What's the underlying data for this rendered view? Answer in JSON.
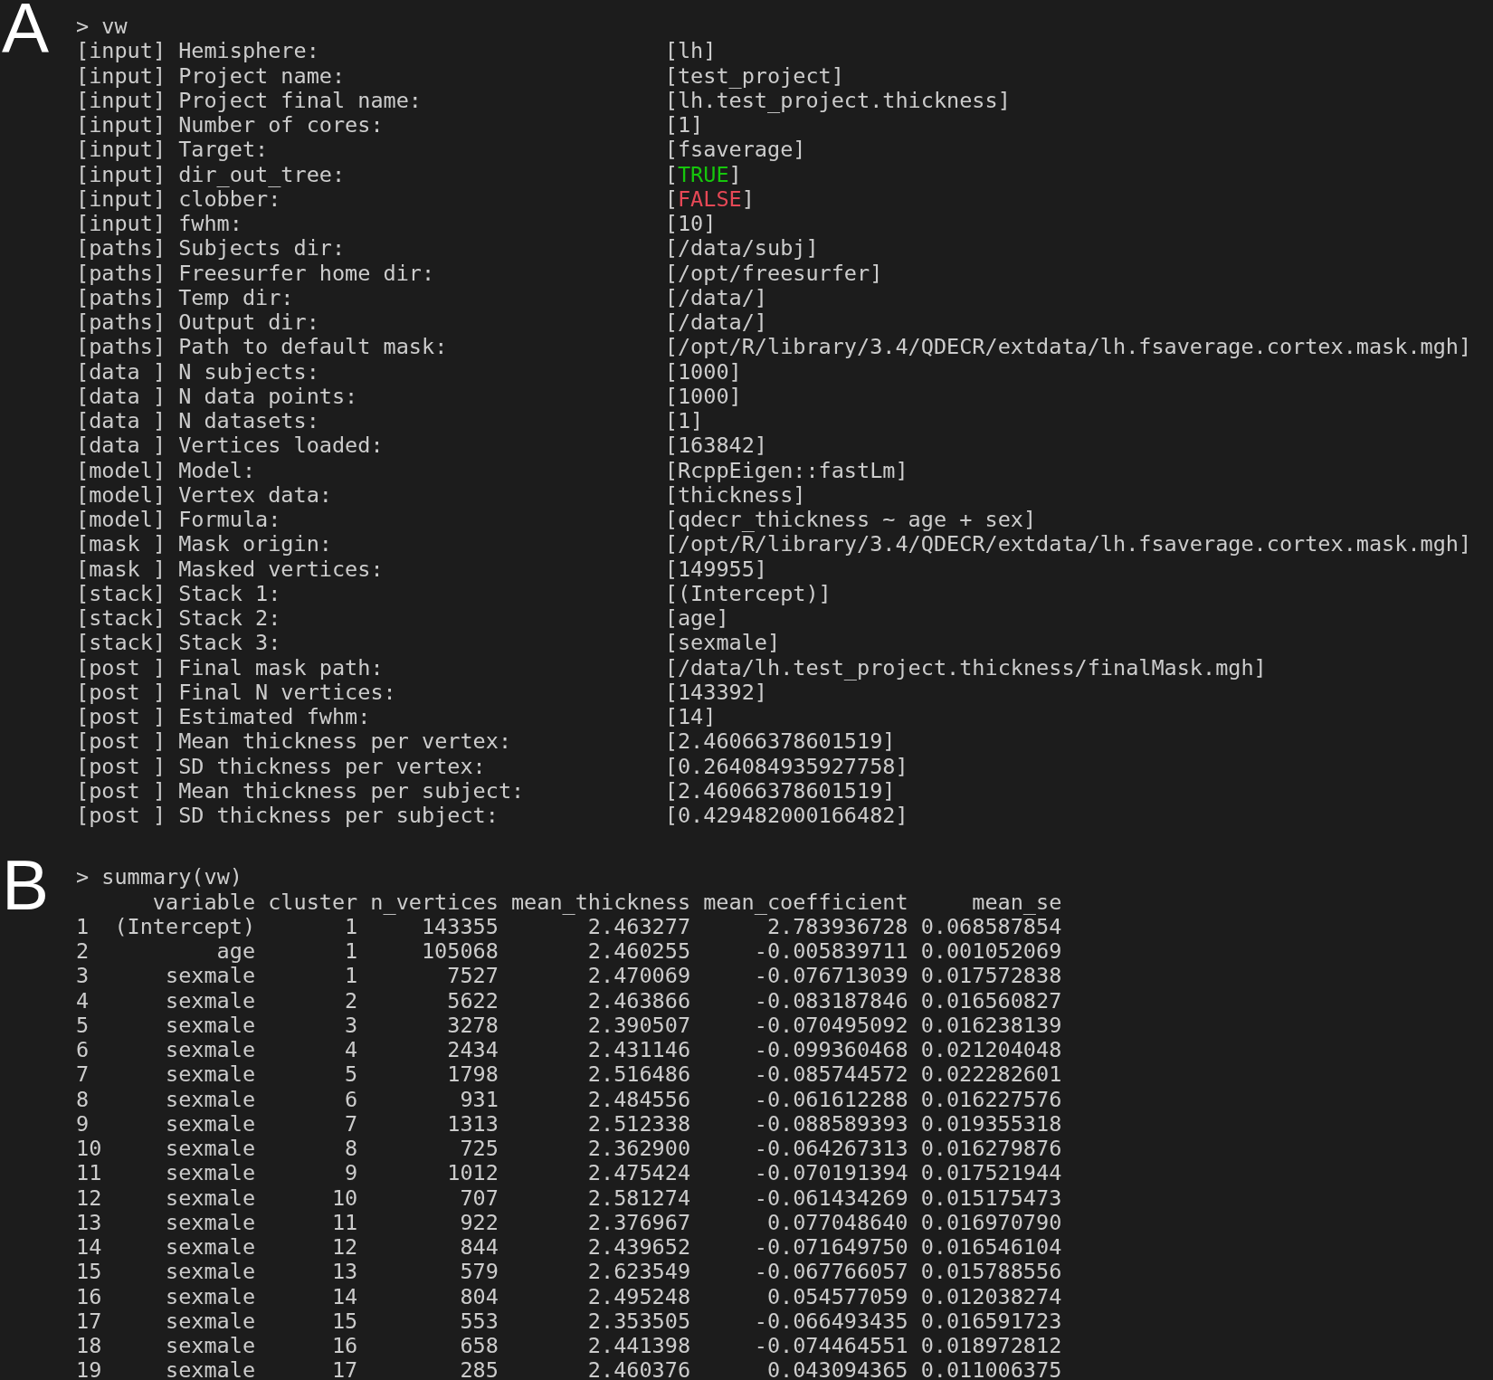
{
  "panel_a": {
    "label": "A",
    "prompt": "> vw",
    "rows": [
      {
        "tag": "[input]",
        "label": "Hemisphere:",
        "value": "[lh]"
      },
      {
        "tag": "[input]",
        "label": "Project name:",
        "value": "[test_project]"
      },
      {
        "tag": "[input]",
        "label": "Project final name:",
        "value": "[lh.test_project.thickness]"
      },
      {
        "tag": "[input]",
        "label": "Number of cores:",
        "value": "[1]"
      },
      {
        "tag": "[input]",
        "label": "Target:",
        "value": "[fsaverage]"
      },
      {
        "tag": "[input]",
        "label": "dir_out_tree:",
        "value": "[TRUE]",
        "color": "#16c60c"
      },
      {
        "tag": "[input]",
        "label": "clobber:",
        "value": "[FALSE]",
        "color": "#e74856"
      },
      {
        "tag": "[input]",
        "label": "fwhm:",
        "value": "[10]"
      },
      {
        "tag": "[paths]",
        "label": "Subjects dir:",
        "value": "[/data/subj]"
      },
      {
        "tag": "[paths]",
        "label": "Freesurfer home dir:",
        "value": "[/opt/freesurfer]"
      },
      {
        "tag": "[paths]",
        "label": "Temp dir:",
        "value": "[/data/]"
      },
      {
        "tag": "[paths]",
        "label": "Output dir:",
        "value": "[/data/]"
      },
      {
        "tag": "[paths]",
        "label": "Path to default mask:",
        "value": "[/opt/R/library/3.4/QDECR/extdata/lh.fsaverage.cortex.mask.mgh]"
      },
      {
        "tag": "[data ]",
        "label": "N subjects:",
        "value": "[1000]"
      },
      {
        "tag": "[data ]",
        "label": "N data points:",
        "value": "[1000]"
      },
      {
        "tag": "[data ]",
        "label": "N datasets:",
        "value": "[1]"
      },
      {
        "tag": "[data ]",
        "label": "Vertices loaded:",
        "value": "[163842]"
      },
      {
        "tag": "[model]",
        "label": "Model:",
        "value": "[RcppEigen::fastLm]"
      },
      {
        "tag": "[model]",
        "label": "Vertex data:",
        "value": "[thickness]"
      },
      {
        "tag": "[model]",
        "label": "Formula:",
        "value": "[qdecr_thickness ~ age + sex]"
      },
      {
        "tag": "[mask ]",
        "label": "Mask origin:",
        "value": "[/opt/R/library/3.4/QDECR/extdata/lh.fsaverage.cortex.mask.mgh]"
      },
      {
        "tag": "[mask ]",
        "label": "Masked vertices:",
        "value": "[149955]"
      },
      {
        "tag": "[stack]",
        "label": "Stack 1:",
        "value": "[(Intercept)]"
      },
      {
        "tag": "[stack]",
        "label": "Stack 2:",
        "value": "[age]"
      },
      {
        "tag": "[stack]",
        "label": "Stack 3:",
        "value": "[sexmale]"
      },
      {
        "tag": "[post ]",
        "label": "Final mask path:",
        "value": "[/data/lh.test_project.thickness/finalMask.mgh]"
      },
      {
        "tag": "[post ]",
        "label": "Final N vertices:",
        "value": "[143392]"
      },
      {
        "tag": "[post ]",
        "label": "Estimated fwhm:",
        "value": "[14]"
      },
      {
        "tag": "[post ]",
        "label": "Mean thickness per vertex:",
        "value": "[2.46066378601519]"
      },
      {
        "tag": "[post ]",
        "label": "SD thickness per vertex:",
        "value": "[0.264084935927758]"
      },
      {
        "tag": "[post ]",
        "label": "Mean thickness per subject:",
        "value": "[2.46066378601519]"
      },
      {
        "tag": "[post ]",
        "label": "SD thickness per subject:",
        "value": "[0.429482000166482]"
      }
    ]
  },
  "panel_b": {
    "label": "B",
    "prompt": "> summary(vw)",
    "table": {
      "columns": [
        "variable",
        "cluster",
        "n_vertices",
        "mean_thickness",
        "mean_coefficient",
        "mean_se"
      ],
      "rows": [
        {
          "row_name": "1",
          "cells": [
            "(Intercept)",
            "1",
            "143355",
            "2.463277",
            "2.783936728",
            "0.068587854"
          ]
        },
        {
          "row_name": "2",
          "cells": [
            "age",
            "1",
            "105068",
            "2.460255",
            "-0.005839711",
            "0.001052069"
          ]
        },
        {
          "row_name": "3",
          "cells": [
            "sexmale",
            "1",
            "7527",
            "2.470069",
            "-0.076713039",
            "0.017572838"
          ]
        },
        {
          "row_name": "4",
          "cells": [
            "sexmale",
            "2",
            "5622",
            "2.463866",
            "-0.083187846",
            "0.016560827"
          ]
        },
        {
          "row_name": "5",
          "cells": [
            "sexmale",
            "3",
            "3278",
            "2.390507",
            "-0.070495092",
            "0.016238139"
          ]
        },
        {
          "row_name": "6",
          "cells": [
            "sexmale",
            "4",
            "2434",
            "2.431146",
            "-0.099360468",
            "0.021204048"
          ]
        },
        {
          "row_name": "7",
          "cells": [
            "sexmale",
            "5",
            "1798",
            "2.516486",
            "-0.085744572",
            "0.022282601"
          ]
        },
        {
          "row_name": "8",
          "cells": [
            "sexmale",
            "6",
            "931",
            "2.484556",
            "-0.061612288",
            "0.016227576"
          ]
        },
        {
          "row_name": "9",
          "cells": [
            "sexmale",
            "7",
            "1313",
            "2.512338",
            "-0.088589393",
            "0.019355318"
          ]
        },
        {
          "row_name": "10",
          "cells": [
            "sexmale",
            "8",
            "725",
            "2.362900",
            "-0.064267313",
            "0.016279876"
          ]
        },
        {
          "row_name": "11",
          "cells": [
            "sexmale",
            "9",
            "1012",
            "2.475424",
            "-0.070191394",
            "0.017521944"
          ]
        },
        {
          "row_name": "12",
          "cells": [
            "sexmale",
            "10",
            "707",
            "2.581274",
            "-0.061434269",
            "0.015175473"
          ]
        },
        {
          "row_name": "13",
          "cells": [
            "sexmale",
            "11",
            "922",
            "2.376967",
            "0.077048640",
            "0.016970790"
          ]
        },
        {
          "row_name": "14",
          "cells": [
            "sexmale",
            "12",
            "844",
            "2.439652",
            "-0.071649750",
            "0.016546104"
          ]
        },
        {
          "row_name": "15",
          "cells": [
            "sexmale",
            "13",
            "579",
            "2.623549",
            "-0.067766057",
            "0.015788556"
          ]
        },
        {
          "row_name": "16",
          "cells": [
            "sexmale",
            "14",
            "804",
            "2.495248",
            "0.054577059",
            "0.012038274"
          ]
        },
        {
          "row_name": "17",
          "cells": [
            "sexmale",
            "15",
            "553",
            "2.353505",
            "-0.066493435",
            "0.016591723"
          ]
        },
        {
          "row_name": "18",
          "cells": [
            "sexmale",
            "16",
            "658",
            "2.441398",
            "-0.074464551",
            "0.018972812"
          ]
        },
        {
          "row_name": "19",
          "cells": [
            "sexmale",
            "17",
            "285",
            "2.460376",
            "0.043094365",
            "0.011006375"
          ]
        }
      ]
    }
  }
}
